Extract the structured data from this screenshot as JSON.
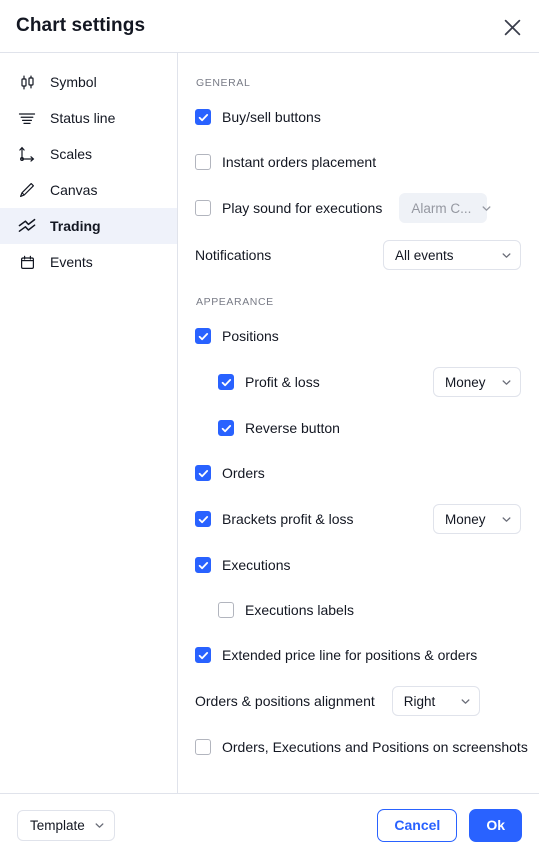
{
  "window": {
    "title": "Chart settings",
    "close_icon": "close-icon"
  },
  "colors": {
    "accent": "#2962ff",
    "text": "#131722",
    "muted": "#787b86",
    "border": "#e0e3eb",
    "active_row_bg": "#eff2fa",
    "disabled_bg": "#eff2f7",
    "disabled_text": "#9598a1"
  },
  "sidebar": {
    "items": [
      {
        "label": "Symbol",
        "icon": "candlestick-icon",
        "active": false
      },
      {
        "label": "Status line",
        "icon": "status-line-icon",
        "active": false
      },
      {
        "label": "Scales",
        "icon": "scales-axis-icon",
        "active": false
      },
      {
        "label": "Canvas",
        "icon": "pencil-icon",
        "active": false
      },
      {
        "label": "Trading",
        "icon": "trading-arrows-icon",
        "active": true
      },
      {
        "label": "Events",
        "icon": "calendar-icon",
        "active": false
      }
    ]
  },
  "sections": {
    "general": {
      "label": "GENERAL",
      "buy_sell_buttons": {
        "label": "Buy/sell buttons",
        "checked": true
      },
      "instant_orders": {
        "label": "Instant orders placement",
        "checked": false
      },
      "play_sound": {
        "label": "Play sound for executions",
        "checked": false,
        "select": {
          "value": "Alarm C...",
          "disabled": true,
          "chevron": "chevron-down-icon"
        }
      },
      "notifications": {
        "label": "Notifications",
        "select": {
          "value": "All events",
          "disabled": false,
          "chevron": "chevron-down-icon"
        }
      }
    },
    "appearance": {
      "label": "APPEARANCE",
      "positions": {
        "label": "Positions",
        "checked": true
      },
      "profit_loss": {
        "label": "Profit & loss",
        "checked": true,
        "select": {
          "value": "Money",
          "disabled": false,
          "chevron": "chevron-down-icon"
        }
      },
      "reverse_button": {
        "label": "Reverse button",
        "checked": true
      },
      "orders": {
        "label": "Orders",
        "checked": true
      },
      "brackets_profit_loss": {
        "label": "Brackets profit & loss",
        "checked": true,
        "select": {
          "value": "Money",
          "disabled": false,
          "chevron": "chevron-down-icon"
        }
      },
      "executions": {
        "label": "Executions",
        "checked": true
      },
      "executions_labels": {
        "label": "Executions labels",
        "checked": false
      },
      "extended_price_line": {
        "label": "Extended price line for positions & orders",
        "checked": true
      },
      "alignment": {
        "label": "Orders & positions alignment",
        "select": {
          "value": "Right",
          "disabled": false,
          "chevron": "chevron-down-icon"
        }
      },
      "screenshots": {
        "label": "Orders, Executions and Positions on screenshots",
        "checked": false
      }
    }
  },
  "footer": {
    "template_label": "Template",
    "template_chevron": "chevron-down-icon",
    "cancel_label": "Cancel",
    "ok_label": "Ok"
  }
}
